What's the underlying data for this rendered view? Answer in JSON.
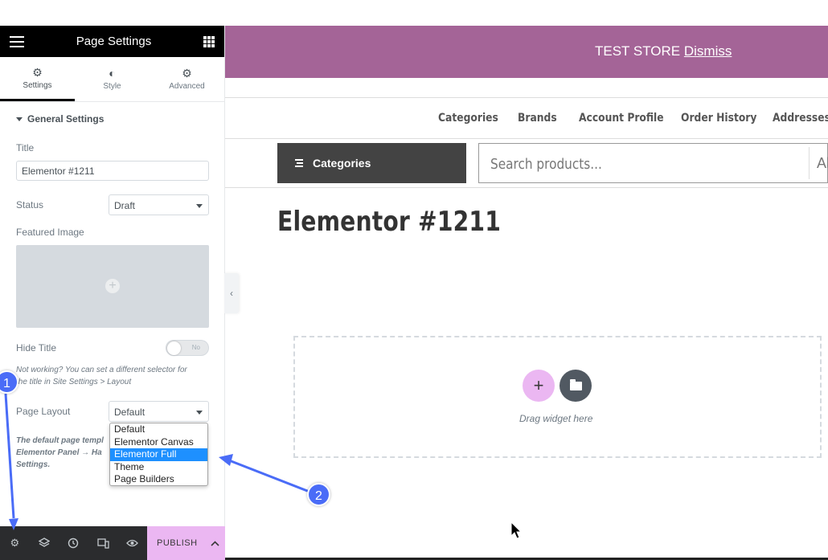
{
  "panel": {
    "title": "Page Settings",
    "tabs": [
      {
        "label": "Settings",
        "icon": "gear-icon"
      },
      {
        "label": "Style",
        "icon": "half-circle-icon"
      },
      {
        "label": "Advanced",
        "icon": "gear-icon"
      }
    ],
    "section_title": "General Settings",
    "title_label": "Title",
    "title_value": "Elementor #1211",
    "status_label": "Status",
    "status_value": "Draft",
    "featured_label": "Featured Image",
    "hide_title_label": "Hide Title",
    "hide_title_toggle": "No",
    "note_line1": "Not working? You can set a different selector for",
    "note_line2": "the title in Site Settings > Layout",
    "page_layout_label": "Page Layout",
    "page_layout_value": "Default",
    "layout_options": [
      "Default",
      "Elementor Canvas",
      "Elementor Full Width",
      "Theme",
      "Page Builders"
    ],
    "layout_selected": "Elementor Full Width",
    "desc_line1": "The default page templ",
    "desc_line2": "Elementor Panel → Ha",
    "desc_line3": "Settings."
  },
  "footer": {
    "icons": [
      "gear-icon",
      "layers-icon",
      "history-icon",
      "responsive-icon",
      "eye-icon"
    ],
    "publish_label": "PUBLISH"
  },
  "site": {
    "banner_text": "TEST STORE",
    "banner_link": "Dismiss",
    "nav": [
      "Categories",
      "Brands",
      "Account Profile",
      "Order History",
      "Addresses"
    ],
    "categories_button": "Categories",
    "search_placeholder": "Search products...",
    "search_dropdown": "Al",
    "page_title": "Elementor #1211",
    "drag_text": "Drag widget here"
  },
  "annotations": {
    "marker1": "1",
    "marker2": "2"
  },
  "colors": {
    "banner": "#a46497",
    "publish": "#ebb7f2",
    "marker": "#4a6cf7",
    "selected_option": "#1e90ff"
  }
}
